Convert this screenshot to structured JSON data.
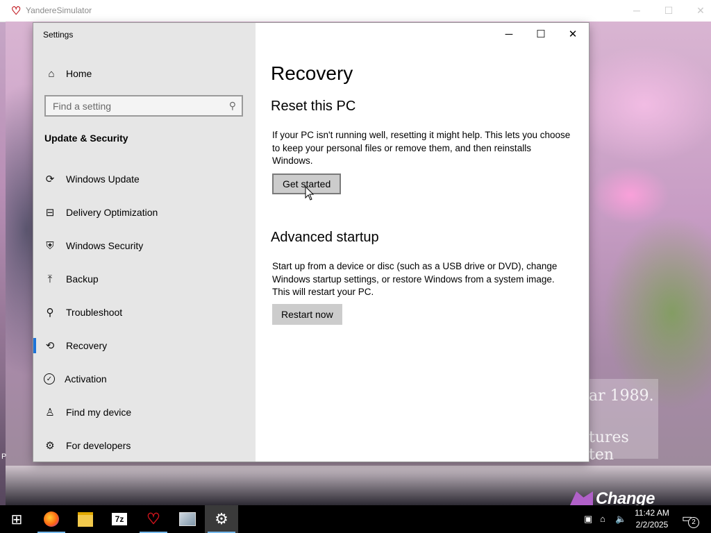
{
  "game_window": {
    "title": "YandereSimulator",
    "caption_line1": "ar 1989.",
    "caption_line2": "tures ten",
    "change_selection": "Change Selection",
    "left_edge_label": "P"
  },
  "settings": {
    "window_title": "Settings",
    "controls": {
      "minimize": "─",
      "maximize": "☐",
      "close": "✕"
    },
    "sidebar": {
      "home_label": "Home",
      "search_placeholder": "Find a setting",
      "section_title": "Update & Security",
      "items": [
        {
          "label": "Windows Update",
          "icon": "refresh-icon",
          "glyph": "⟳",
          "selected": false
        },
        {
          "label": "Delivery Optimization",
          "icon": "delivery-optimization-icon",
          "glyph": "⊟",
          "selected": false
        },
        {
          "label": "Windows Security",
          "icon": "shield-icon",
          "glyph": "⛨",
          "selected": false
        },
        {
          "label": "Backup",
          "icon": "backup-arrow-icon",
          "glyph": "⤒",
          "selected": false
        },
        {
          "label": "Troubleshoot",
          "icon": "wrench-icon",
          "glyph": "⚲",
          "selected": false
        },
        {
          "label": "Recovery",
          "icon": "recovery-clock-icon",
          "glyph": "⟲",
          "selected": true
        },
        {
          "label": "Activation",
          "icon": "check-circle-icon",
          "glyph": "✓",
          "selected": false
        },
        {
          "label": "Find my device",
          "icon": "person-location-icon",
          "glyph": "♙",
          "selected": false
        },
        {
          "label": "For developers",
          "icon": "developer-tools-icon",
          "glyph": "⚙",
          "selected": false
        }
      ],
      "accent_color": "#1d74d8"
    },
    "content": {
      "title": "Recovery",
      "reset": {
        "heading": "Reset this PC",
        "description": "If your PC isn't running well, resetting it might help. This lets you choose to keep your personal files or remove them, and then reinstalls Windows.",
        "button_label": "Get started"
      },
      "advanced": {
        "heading": "Advanced startup",
        "description": "Start up from a device or disc (such as a USB drive or DVD), change Windows startup settings, or restore Windows from a system image. This will restart your PC.",
        "button_label": "Restart now"
      }
    }
  },
  "taskbar": {
    "apps": [
      {
        "name": "start-button",
        "icon": "windows-logo-icon",
        "glyph": "⊞",
        "active": false
      },
      {
        "name": "taskbar-firefox",
        "icon": "firefox-icon",
        "glyph": "●",
        "active": false
      },
      {
        "name": "taskbar-file-explorer",
        "icon": "folder-icon",
        "glyph": "▬",
        "active": false
      },
      {
        "name": "taskbar-7zip",
        "icon": "7zip-icon",
        "glyph": "7z",
        "active": false
      },
      {
        "name": "taskbar-yandere-simulator",
        "icon": "yandere-heart-icon",
        "glyph": "♡",
        "active": false
      },
      {
        "name": "taskbar-control-panel",
        "icon": "control-panel-icon",
        "glyph": "▦",
        "active": false
      },
      {
        "name": "taskbar-settings",
        "icon": "settings-gear-icon",
        "glyph": "⚙",
        "active": true
      }
    ],
    "clock_time": "11:42 AM",
    "clock_date": "2/2/2025",
    "notification_count": "2"
  }
}
